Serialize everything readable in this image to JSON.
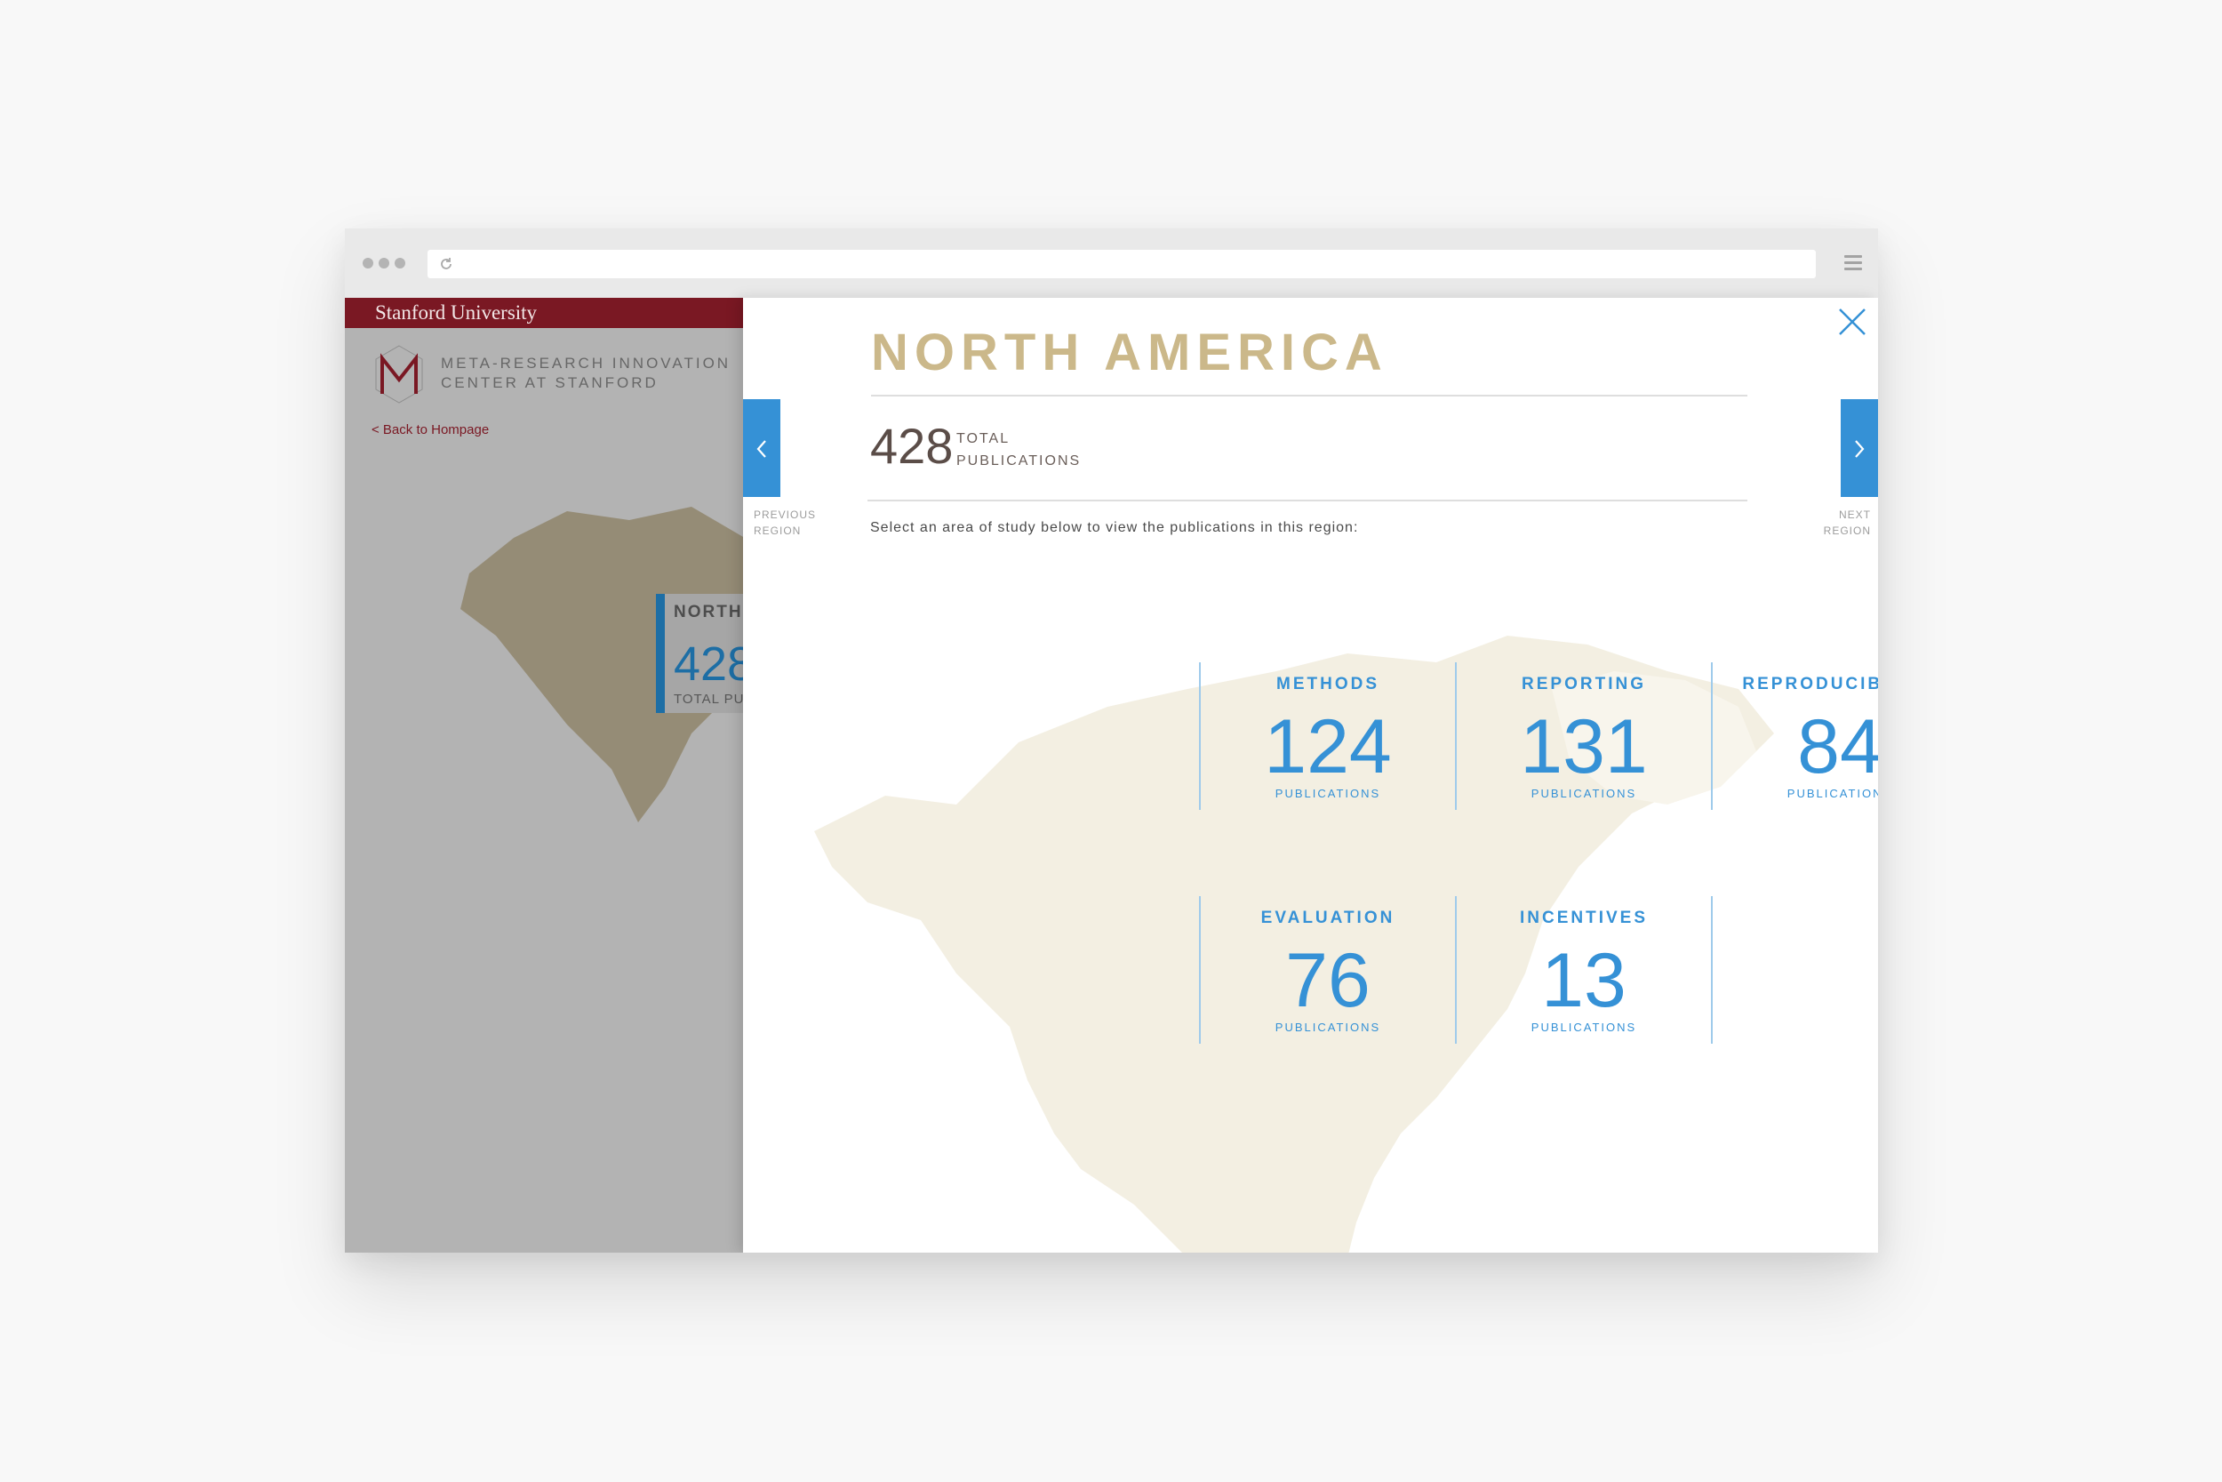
{
  "browser": {
    "url": ""
  },
  "background_page": {
    "university": "Stanford University",
    "org_line1": "META-RESEARCH INNOVATION",
    "org_line2": "CENTER AT STANFORD",
    "back_link": "< Back to Hompage",
    "region_card": {
      "title": "NORTH",
      "count": "428",
      "label": "TOTAL PUB"
    }
  },
  "modal": {
    "region": "NORTH AMERICA",
    "total": "428",
    "total_label_line1": "TOTAL",
    "total_label_line2": "PUBLICATIONS",
    "instruction": "Select an area of study below to view the publications in this region:",
    "prev_caption_line1": "PREVIOUS",
    "prev_caption_line2": "REGION",
    "next_caption_line1": "NEXT",
    "next_caption_line2": "REGION",
    "tiles": [
      {
        "name": "METHODS",
        "count": "124",
        "unit": "PUBLICATIONS"
      },
      {
        "name": "REPORTING",
        "count": "131",
        "unit": "PUBLICATIONS"
      },
      {
        "name": "REPRODUCIBILITY",
        "count": "84",
        "unit": "PUBLICATIONS"
      },
      {
        "name": "EVALUATION",
        "count": "76",
        "unit": "PUBLICATIONS"
      },
      {
        "name": "INCENTIVES",
        "count": "13",
        "unit": "PUBLICATIONS"
      }
    ]
  },
  "colors": {
    "accent_blue": "#3591d6",
    "gold": "#cbb88a",
    "stanford_red": "#7a1823"
  },
  "icons": [
    "reload-icon",
    "hamburger-menu-icon",
    "close-icon",
    "chevron-left-icon",
    "chevron-right-icon",
    "mirc-logo-icon"
  ]
}
